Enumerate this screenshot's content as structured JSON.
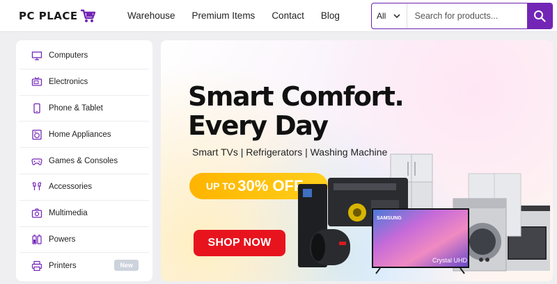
{
  "header": {
    "logo_text": "PC PLACE",
    "nav": [
      "Warehouse",
      "Premium Items",
      "Contact",
      "Blog"
    ],
    "search": {
      "category": "All",
      "placeholder": "Search for products..."
    }
  },
  "sidebar": {
    "items": [
      {
        "label": "Computers",
        "icon": "monitor-icon"
      },
      {
        "label": "Electronics",
        "icon": "tv-icon"
      },
      {
        "label": "Phone & Tablet",
        "icon": "phone-icon"
      },
      {
        "label": "Home Appliances",
        "icon": "washing-machine-icon"
      },
      {
        "label": "Games & Consoles",
        "icon": "gamepad-icon"
      },
      {
        "label": "Accessories",
        "icon": "earphones-icon"
      },
      {
        "label": "Multimedia",
        "icon": "camera-icon"
      },
      {
        "label": "Powers",
        "icon": "battery-icon"
      },
      {
        "label": "Printers",
        "icon": "printer-icon",
        "badge": "New"
      }
    ]
  },
  "banner": {
    "headline_line1": "Smart Comfort.",
    "headline_line2": "Every Day",
    "subline": "Smart TVs | Refrigerators | Washing Machine",
    "promo_prefix": "UP TO",
    "promo_value": "30% OFF",
    "cta": "SHOP NOW",
    "tv_brand": "SAMSUNG",
    "tv_caption": "Crystal UHD"
  },
  "colors": {
    "accent": "#7326b6",
    "promo": "#ffbd0a",
    "cta": "#e7141e"
  }
}
